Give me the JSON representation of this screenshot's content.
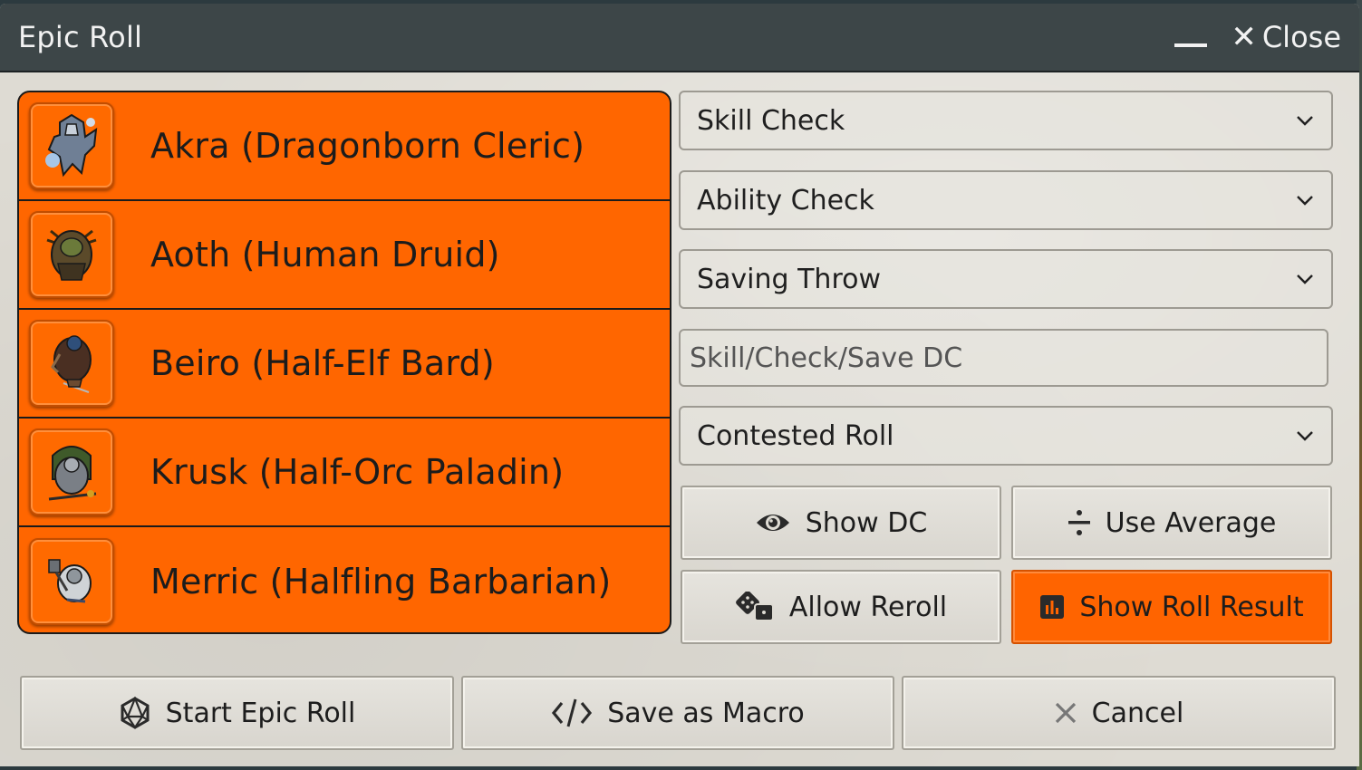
{
  "window": {
    "title": "Epic Roll",
    "minimize_label": "",
    "close_label": "Close"
  },
  "actors": [
    {
      "name": "Akra (Dragonborn Cleric)",
      "icon": "dragonborn-cleric-token"
    },
    {
      "name": "Aoth (Human Druid)",
      "icon": "human-druid-token"
    },
    {
      "name": "Beiro (Half-Elf Bard)",
      "icon": "half-elf-bard-token"
    },
    {
      "name": "Krusk (Half-Orc Paladin)",
      "icon": "half-orc-paladin-token"
    },
    {
      "name": "Merric (Halfling Barbarian)",
      "icon": "halfling-barbarian-token"
    }
  ],
  "selects": {
    "skill_check": "Skill Check",
    "ability_check": "Ability Check",
    "saving_throw": "Saving Throw",
    "contested_roll": "Contested Roll"
  },
  "dc_input": {
    "placeholder": "Skill/Check/Save DC",
    "value": ""
  },
  "toggles": {
    "show_dc": "Show DC",
    "use_average": "Use Average",
    "allow_reroll": "Allow Reroll",
    "show_roll_result": "Show Roll Result"
  },
  "actions": {
    "start": "Start Epic Roll",
    "save_macro": "Save as Macro",
    "cancel": "Cancel"
  },
  "colors": {
    "accent": "#ff6600",
    "titlebar": "#3d4648",
    "panel": "#dedbd3"
  }
}
